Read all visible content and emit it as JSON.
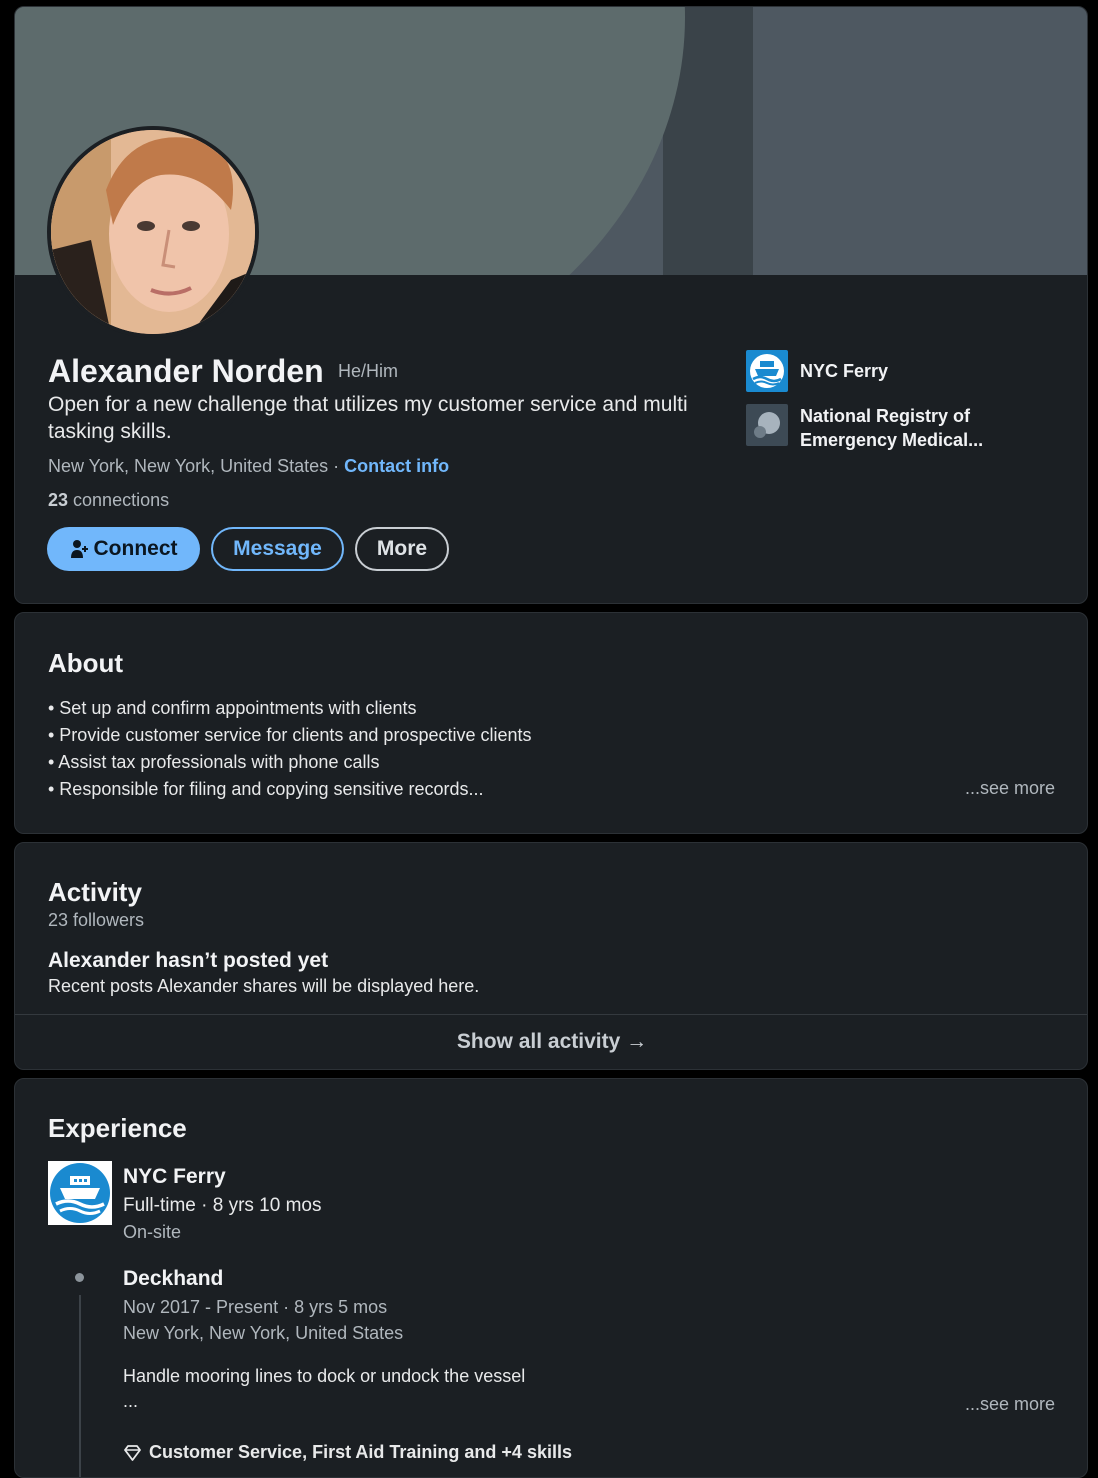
{
  "profile": {
    "name": "Alexander Norden",
    "pronouns": "He/Him",
    "headline": "Open for a new challenge that utilizes my customer service and multi tasking skills.",
    "location": "New York, New York, United States",
    "separator": " · ",
    "contact_info": "Contact info",
    "connections_count": "23",
    "connections_label": " connections",
    "buttons": {
      "connect": "Connect",
      "message": "Message",
      "more": "More"
    },
    "orgs": [
      {
        "name": "NYC Ferry",
        "logo_icon": "nyc-ferry-logo"
      },
      {
        "name": "National Registry of Emergency Medical...",
        "logo_icon": "nremt-logo"
      }
    ]
  },
  "about": {
    "title": "About",
    "lines": [
      "• Set up and confirm appointments with clients",
      "• Provide customer service for clients and prospective clients",
      "• Assist tax professionals with phone calls",
      "• Responsible for filing and copying sensitive records..."
    ],
    "see_more": "...see more"
  },
  "activity": {
    "title": "Activity",
    "followers": "23 followers",
    "empty_title": "Alexander hasn’t posted yet",
    "empty_sub": "Recent posts Alexander shares will be displayed here.",
    "show_all": "Show all activity →"
  },
  "experience": {
    "title": "Experience",
    "company": "NYC Ferry",
    "employment": "Full-time · 8 yrs 10 mos",
    "site": "On-site",
    "role": {
      "title": "Deckhand",
      "dates": "Nov 2017 - Present · 8 yrs 5 mos",
      "location": "New York, New York, United States",
      "description": "Handle mooring lines to dock or undock the vessel",
      "ellipsis": "...",
      "see_more": "...see more",
      "skills": "Customer Service, First Aid Training and +4 skills"
    }
  },
  "colors": {
    "accent": "#71b7fb",
    "card": "#1b1f23",
    "banner": "#4e5861",
    "ferry_blue": "#1a8ad0"
  }
}
